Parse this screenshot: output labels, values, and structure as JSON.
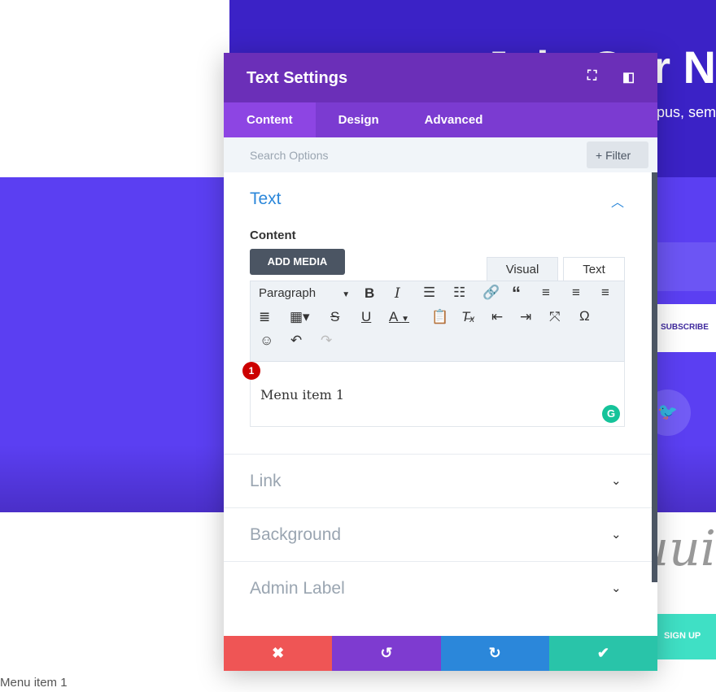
{
  "page": {
    "hero_title": "Join Our N",
    "hero_subtitle": "pus, sem",
    "subscribe_label": "SUBSCRIBE",
    "script_text": "uui",
    "signup_label": "SIGN UP",
    "footer_text": "Menu item 1"
  },
  "modal": {
    "title": "Text Settings",
    "tabs": [
      {
        "label": "Content",
        "active": true
      },
      {
        "label": "Design"
      },
      {
        "label": "Advanced"
      }
    ],
    "search_placeholder": "Search Options",
    "filter_label": "+ Filter",
    "section_title": "Text",
    "content_label": "Content",
    "add_media_label": "ADD MEDIA",
    "editor_tabs": {
      "visual": "Visual",
      "text": "Text"
    },
    "format_select": "Paragraph",
    "editor_content": "Menu item 1",
    "badge_number": "1",
    "sections": [
      {
        "label": "Link"
      },
      {
        "label": "Background"
      },
      {
        "label": "Admin Label"
      }
    ],
    "colors": {
      "header": "#6b2fb8",
      "tabs": "#7b3bd1",
      "cancel": "#ef5555",
      "undo": "#7e3bd0",
      "redo": "#2b87da",
      "save": "#29c4a9"
    }
  }
}
